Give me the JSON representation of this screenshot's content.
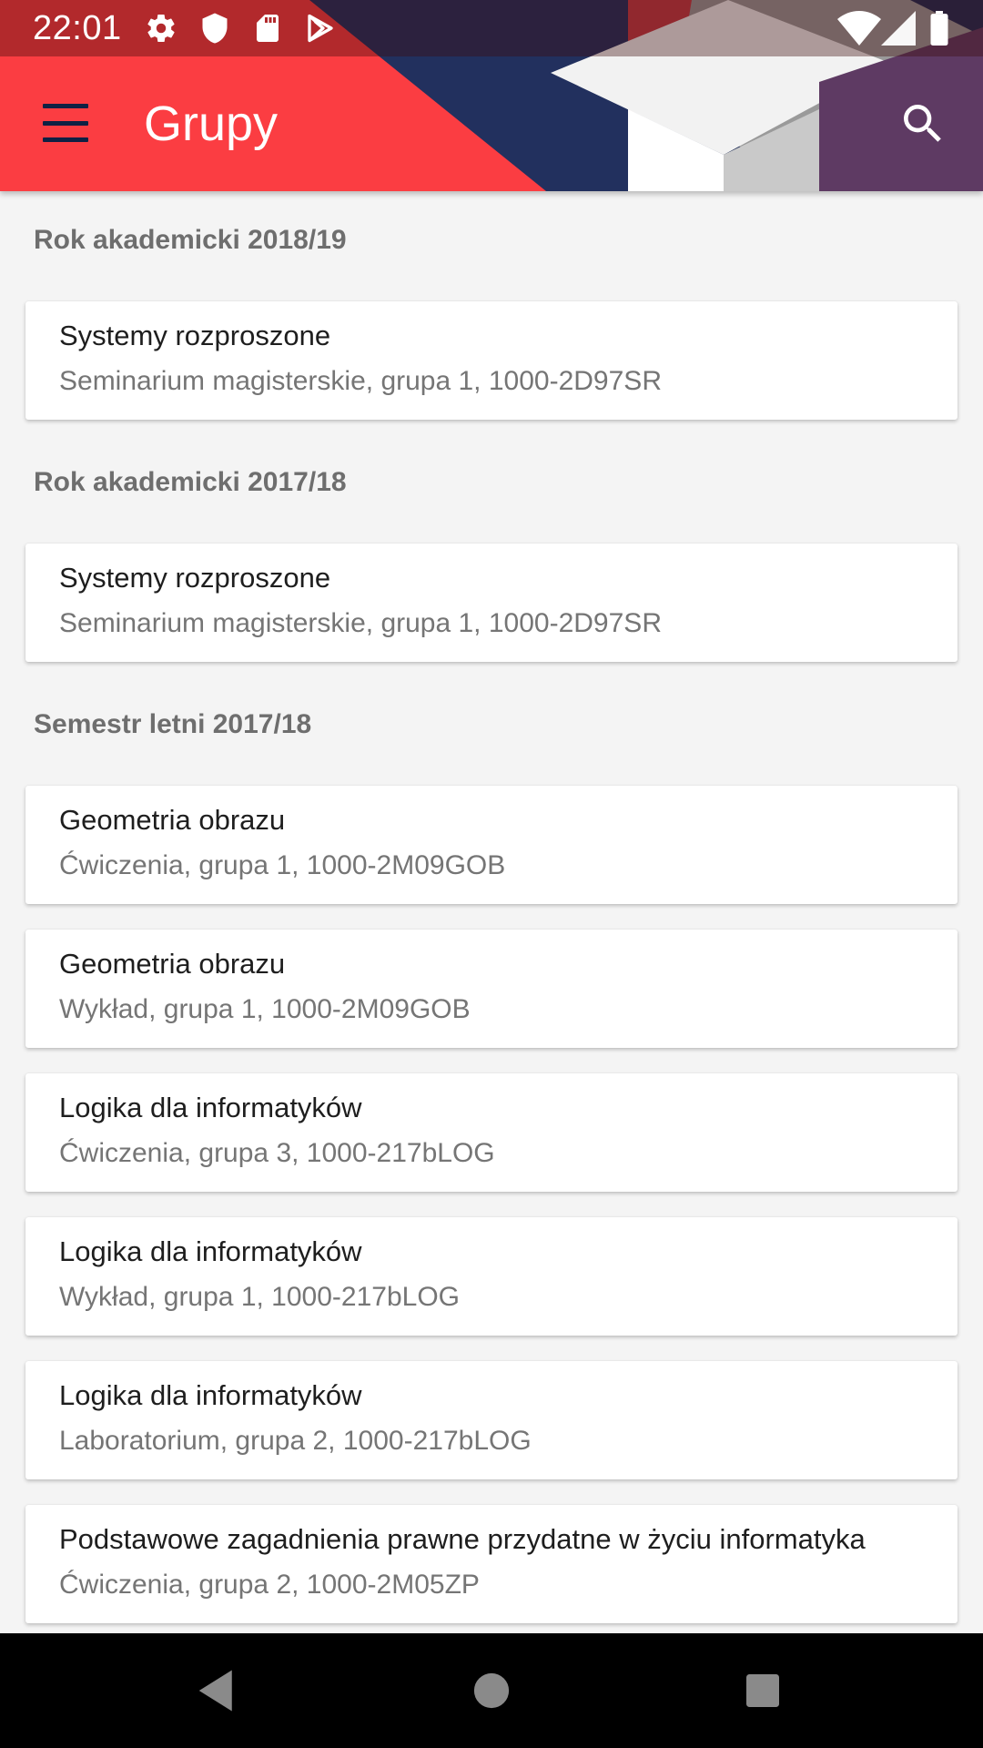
{
  "status_bar": {
    "time": "22:01",
    "left_icons": [
      "gear-icon",
      "shield-icon",
      "sd-card-icon",
      "play-store-icon"
    ],
    "right_icons": [
      "wifi-icon",
      "signal-icon",
      "battery-icon"
    ]
  },
  "app_bar": {
    "menu_icon": "menu-icon",
    "title": "Grupy",
    "search_icon": "search-icon"
  },
  "sections": [
    {
      "label": "Rok akademicki 2018/19",
      "items": [
        {
          "title": "Systemy rozproszone",
          "subtitle": "Seminarium magisterskie, grupa 1, 1000-2D97SR"
        }
      ]
    },
    {
      "label": "Rok akademicki 2017/18",
      "items": [
        {
          "title": "Systemy rozproszone",
          "subtitle": "Seminarium magisterskie, grupa 1, 1000-2D97SR"
        }
      ]
    },
    {
      "label": "Semestr letni 2017/18",
      "items": [
        {
          "title": "Geometria obrazu",
          "subtitle": "Ćwiczenia, grupa 1, 1000-2M09GOB"
        },
        {
          "title": "Geometria obrazu",
          "subtitle": "Wykład, grupa 1, 1000-2M09GOB"
        },
        {
          "title": "Logika dla informatyków",
          "subtitle": "Ćwiczenia, grupa 3, 1000-217bLOG"
        },
        {
          "title": "Logika dla informatyków",
          "subtitle": "Wykład, grupa 1, 1000-217bLOG"
        },
        {
          "title": "Logika dla informatyków",
          "subtitle": "Laboratorium, grupa 2, 1000-217bLOG"
        },
        {
          "title": "Podstawowe zagadnienia prawne przydatne w życiu informatyka",
          "subtitle": "Ćwiczenia, grupa 2, 1000-2M05ZP"
        }
      ]
    }
  ],
  "nav_bar": {
    "icons": [
      "back-icon",
      "home-icon",
      "recents-icon"
    ]
  },
  "colors": {
    "app_bar": "#fb3d42",
    "accent_navy": "#22305e",
    "background": "#f4f4f4",
    "card": "#ffffff"
  }
}
